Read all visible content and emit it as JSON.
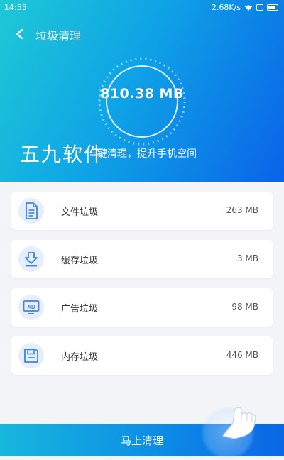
{
  "status": {
    "time": "14:55",
    "speed": "2.68K/s"
  },
  "nav": {
    "title": "垃圾清理"
  },
  "summary": {
    "size": "810.38 MB",
    "subtitle": "一键清理，提升手机空间"
  },
  "watermark": "五九软件",
  "items": [
    {
      "label": "文件垃圾",
      "value": "263 MB",
      "icon": "document-icon"
    },
    {
      "label": "缓存垃圾",
      "value": "3 MB",
      "icon": "download-icon"
    },
    {
      "label": "广告垃圾",
      "value": "98 MB",
      "icon": "ad-icon"
    },
    {
      "label": "内存垃圾",
      "value": "446 MB",
      "icon": "save-icon"
    }
  ],
  "actions": {
    "clean_label": "马上清理"
  },
  "colors": {
    "accent": "#0a63e8",
    "accent_light": "#1ec9d6",
    "icon_blue": "#3a86e6",
    "icon_bg": "#e6eefb"
  }
}
